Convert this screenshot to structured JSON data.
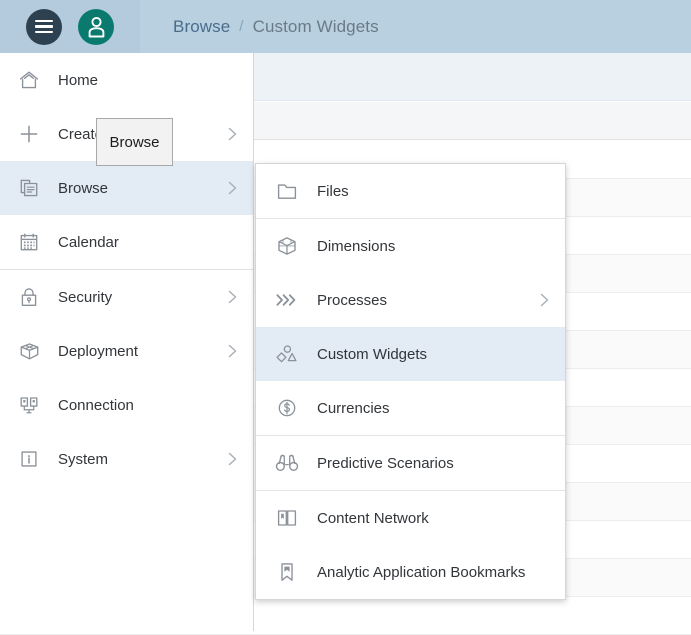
{
  "header": {
    "menu_button": "menu-icon",
    "avatar_button": "user-avatar",
    "breadcrumb": {
      "parent": "Browse",
      "separator": "/",
      "current": "Custom Widgets"
    }
  },
  "tooltip": {
    "text": "Browse"
  },
  "sidebar": {
    "items": [
      {
        "label": "Home",
        "icon": "home-icon",
        "chevron": false,
        "active": false,
        "separator_after": false
      },
      {
        "label": "Create",
        "icon": "plus-icon",
        "chevron": true,
        "active": false,
        "separator_after": false
      },
      {
        "label": "Browse",
        "icon": "browse-icon",
        "chevron": true,
        "active": true,
        "separator_after": false
      },
      {
        "label": "Calendar",
        "icon": "calendar-icon",
        "chevron": false,
        "active": false,
        "separator_after": true
      },
      {
        "label": "Security",
        "icon": "lock-icon",
        "chevron": true,
        "active": false,
        "separator_after": false
      },
      {
        "label": "Deployment",
        "icon": "package-icon",
        "chevron": true,
        "active": false,
        "separator_after": false
      },
      {
        "label": "Connection",
        "icon": "connection-icon",
        "chevron": false,
        "active": false,
        "separator_after": false
      },
      {
        "label": "System",
        "icon": "info-icon",
        "chevron": true,
        "active": false,
        "separator_after": false
      }
    ]
  },
  "dropdown": {
    "items": [
      {
        "label": "Files",
        "icon": "folder-icon",
        "chevron": false,
        "active": false,
        "separator_after": true
      },
      {
        "label": "Dimensions",
        "icon": "cube-icon",
        "chevron": false,
        "active": false,
        "separator_after": false
      },
      {
        "label": "Processes",
        "icon": "chevrons-icon",
        "chevron": true,
        "active": false,
        "separator_after": false
      },
      {
        "label": "Custom Widgets",
        "icon": "shapes-icon",
        "chevron": false,
        "active": true,
        "separator_after": false
      },
      {
        "label": "Currencies",
        "icon": "currency-icon",
        "chevron": false,
        "active": false,
        "separator_after": true
      },
      {
        "label": "Predictive Scenarios",
        "icon": "binoculars-icon",
        "chevron": false,
        "active": false,
        "separator_after": true
      },
      {
        "label": "Content Network",
        "icon": "book-icon",
        "chevron": false,
        "active": false,
        "separator_after": false
      },
      {
        "label": "Analytic Application Bookmarks",
        "icon": "bookmark-icon",
        "chevron": false,
        "active": false,
        "separator_after": false
      }
    ]
  },
  "background_table": {
    "row_count": 13
  },
  "colors": {
    "header_bg": "#b8d0e0",
    "menu_circle": "#2e4150",
    "avatar_circle": "#0a7a6e",
    "selected_row": "#e3ebf4",
    "toolbar_bg": "#edf2f7",
    "tooltip_bg": "#f2f2f2"
  }
}
